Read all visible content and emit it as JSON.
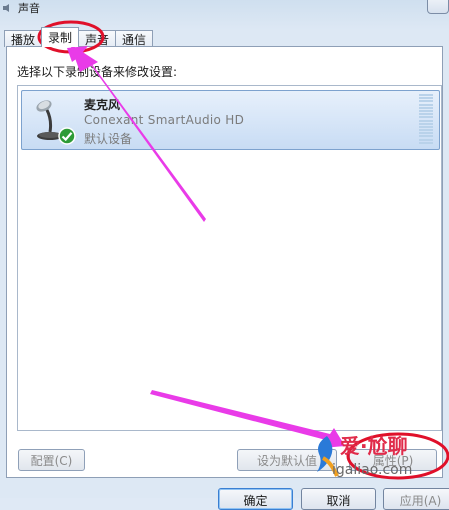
{
  "window": {
    "title": "声音"
  },
  "tabs": [
    {
      "label": "播放"
    },
    {
      "label": "录制"
    },
    {
      "label": "声音"
    },
    {
      "label": "通信"
    }
  ],
  "active_tab": "录制",
  "instruction": "选择以下录制设备来修改设置:",
  "device": {
    "name": "麦克风",
    "driver": "Conexant SmartAudio HD",
    "status": "默认设备",
    "icon": "microphone-icon",
    "status_icon": "green-check-icon"
  },
  "buttons": {
    "configure": "配置(C)",
    "set_default": "设为默认值",
    "properties": "属性(P)"
  },
  "footer": {
    "ok": "确定",
    "cancel": "取消",
    "apply": "应用(A)"
  },
  "watermark": {
    "brand": "爱·尬聊",
    "url": "igaliao.com"
  },
  "annotation_color": "#e93be8",
  "highlight_color": "#e0102a"
}
